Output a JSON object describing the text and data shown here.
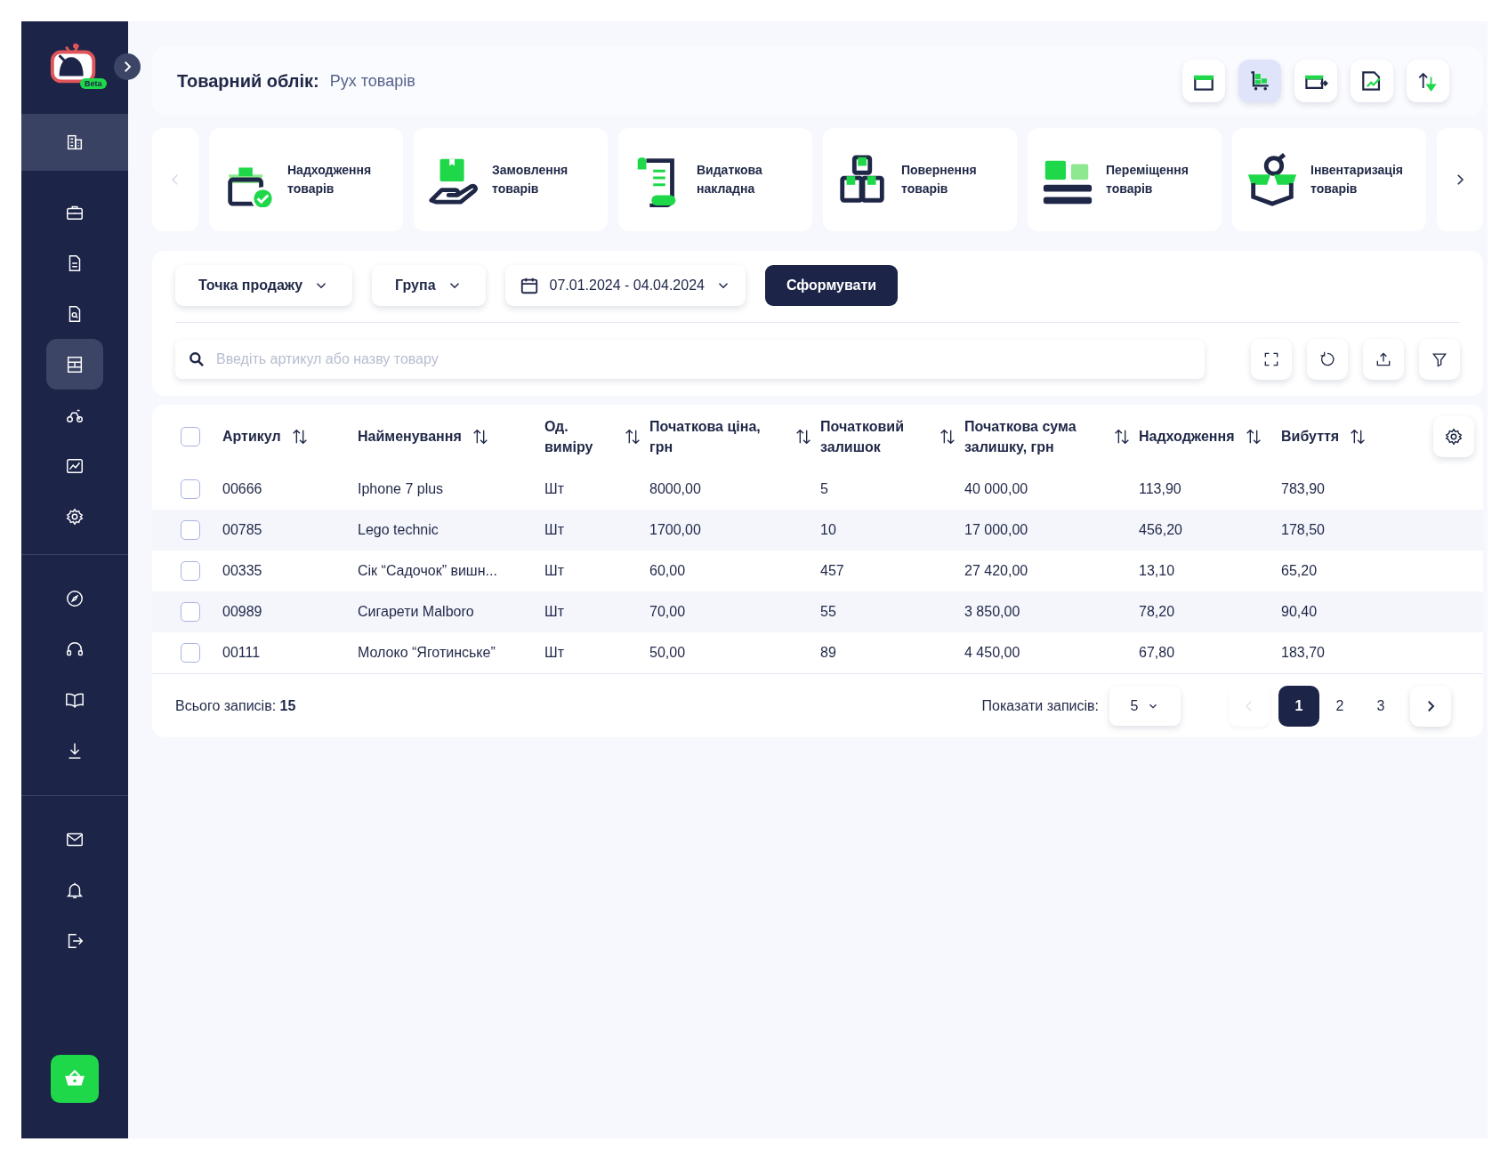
{
  "sidebar": {
    "logo_badge": "Beta",
    "groups": [
      [
        {
          "selected": true
        }
      ],
      [
        {
          "selected": false
        },
        {
          "selected": false
        },
        {
          "selected": false
        },
        {
          "selected": true
        },
        {
          "selected": false
        },
        {
          "selected": false
        },
        {
          "selected": false
        }
      ],
      [
        {
          "selected": false
        },
        {
          "selected": false
        },
        {
          "selected": false
        },
        {
          "selected": false
        }
      ],
      [
        {
          "selected": false
        },
        {
          "selected": false
        },
        {
          "selected": false
        }
      ]
    ]
  },
  "header": {
    "title": "Товарний облік:",
    "subtitle": "Рух товарів",
    "tools": [
      {
        "selected": false
      },
      {
        "selected": true
      },
      {
        "selected": false
      },
      {
        "selected": false
      },
      {
        "selected": false
      }
    ]
  },
  "operations": {
    "prev_disabled": true,
    "cards": [
      {
        "label": "Надходження товарів"
      },
      {
        "label": "Замовлення товарів"
      },
      {
        "label": "Видаткова накладна"
      },
      {
        "label": "Повернення товарів"
      },
      {
        "label": "Переміщення товарів"
      },
      {
        "label": "Інвентаризація товарів"
      }
    ]
  },
  "filters": {
    "dropdowns": [
      "Точка продажу",
      "Група"
    ],
    "date_range": "07.01.2024 - 04.04.2024",
    "submit": "Сформувати",
    "search": {
      "placeholder": "Введіть артикул або назву товару"
    }
  },
  "table": {
    "select_all_checked": false,
    "columns": [
      "Артикул",
      "Найменування",
      "Од. виміру",
      "Початкова ціна, грн",
      "Початковий залишок",
      "Початкова сума залишку, грн",
      "Надходження",
      "Вибуття"
    ],
    "rows": [
      {
        "checked": false,
        "cells": [
          "00666",
          "Iphone 7 plus",
          "Шт",
          "8000,00",
          "5",
          "40 000,00",
          "113,90",
          "783,90"
        ]
      },
      {
        "checked": false,
        "cells": [
          "00785",
          "Lego technic",
          "Шт",
          "1700,00",
          "10",
          "17 000,00",
          "456,20",
          "178,50"
        ]
      },
      {
        "checked": false,
        "cells": [
          "00335",
          "Сік “Садочок” вишн...",
          "Шт",
          "60,00",
          "457",
          "27 420,00",
          "13,10",
          "65,20"
        ]
      },
      {
        "checked": false,
        "cells": [
          "00989",
          "Сигарети Malboro",
          "Шт",
          "70,00",
          "55",
          "3 850,00",
          "78,20",
          "90,40"
        ]
      },
      {
        "checked": false,
        "cells": [
          "00111",
          "Молоко “Яготинське”",
          "Шт",
          "50,00",
          "89",
          "4 450,00",
          "67,80",
          "183,70"
        ]
      }
    ]
  },
  "footer": {
    "total_label": "Всього записів:",
    "total": "15",
    "page_size_label": "Показати записів:",
    "page_size": "5",
    "prev_disabled": true,
    "pages": [
      {
        "label": "1",
        "selected": true
      },
      {
        "label": "2",
        "selected": false
      },
      {
        "label": "3",
        "selected": false
      }
    ]
  }
}
